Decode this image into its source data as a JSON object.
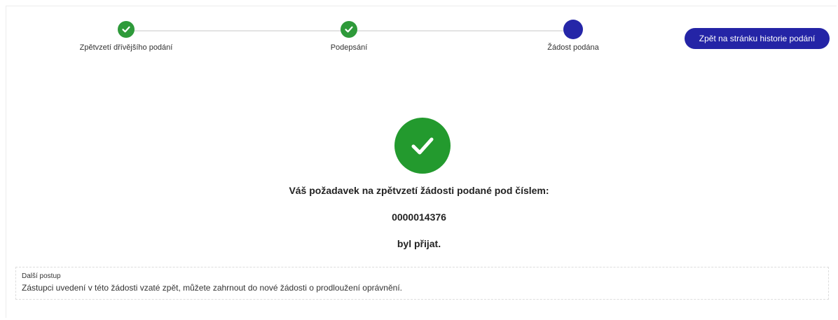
{
  "stepper": {
    "steps": [
      {
        "label": "Zpětvzetí dřívějšího podání",
        "state": "done"
      },
      {
        "label": "Podepsání",
        "state": "done"
      },
      {
        "label": "Žádost podána",
        "state": "current"
      }
    ],
    "back_button_label": "Zpět na stránku historie podání"
  },
  "result": {
    "line1": "Váš požadavek na zpětvzetí žádosti podané pod číslem:",
    "request_number": "0000014376",
    "line3": "byl přijat."
  },
  "info": {
    "title": "Další postup",
    "text": "Zástupci uvedení v této žádosti vzaté zpět, můžete zahrnout do nové žádosti o prodloužení oprávnění."
  },
  "colors": {
    "success_green": "#239a2e",
    "primary_blue": "#2424a6"
  },
  "icons": {
    "step_done": "check-icon",
    "success": "check-circle-icon"
  }
}
